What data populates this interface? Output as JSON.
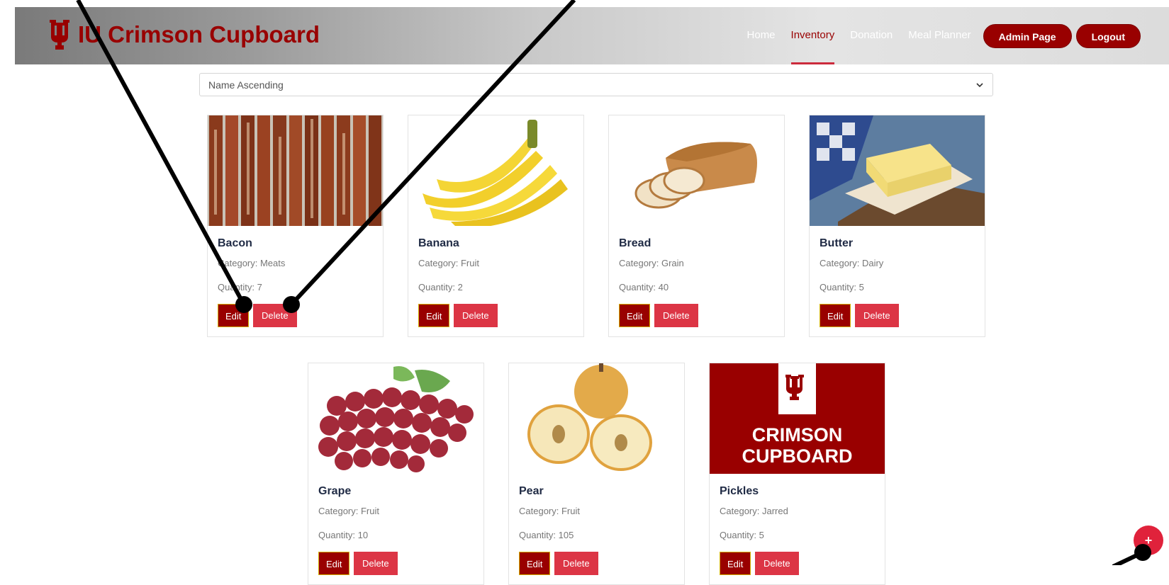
{
  "brand": {
    "name": "IU Crimson Cupboard"
  },
  "nav": {
    "links": [
      "Home",
      "Inventory",
      "Donation",
      "Meal Planner"
    ],
    "active": "Inventory",
    "admin_label": "Admin Page",
    "logout_label": "Logout"
  },
  "sort": {
    "selected": "Name Ascending"
  },
  "items": [
    {
      "name": "Bacon",
      "category": "Category: Meats",
      "quantity": "Quantity: 7",
      "edit": "Edit",
      "delete": "Delete"
    },
    {
      "name": "Banana",
      "category": "Category: Fruit",
      "quantity": "Quantity: 2",
      "edit": "Edit",
      "delete": "Delete"
    },
    {
      "name": "Bread",
      "category": "Category: Grain",
      "quantity": "Quantity: 40",
      "edit": "Edit",
      "delete": "Delete"
    },
    {
      "name": "Butter",
      "category": "Category: Dairy",
      "quantity": "Quantity: 5",
      "edit": "Edit",
      "delete": "Delete"
    },
    {
      "name": "Grape",
      "category": "Category: Fruit",
      "quantity": "Quantity: 10",
      "edit": "Edit",
      "delete": "Delete"
    },
    {
      "name": "Pear",
      "category": "Category: Fruit",
      "quantity": "Quantity: 105",
      "edit": "Edit",
      "delete": "Delete"
    },
    {
      "name": "Pickles",
      "category": "Category: Jarred",
      "quantity": "Quantity: 5",
      "edit": "Edit",
      "delete": "Delete"
    }
  ],
  "placeholder_image": {
    "line1": "CRIMSON",
    "line2": "CUPBOARD"
  },
  "fab": {
    "label": "+"
  },
  "colors": {
    "crimson": "#990000",
    "delete_red": "#dc3545",
    "fab_red": "#e0223b",
    "title_navy": "#1f2a44"
  },
  "icons": {
    "brand": "iu-trident-icon",
    "sort": "chevron-down-icon"
  }
}
